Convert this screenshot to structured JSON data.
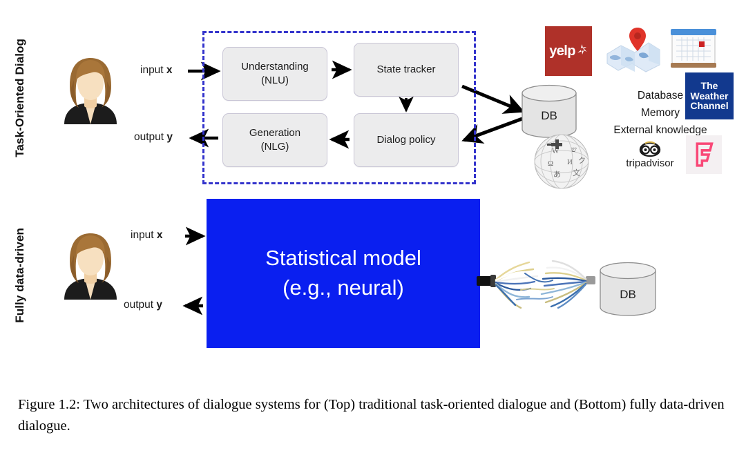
{
  "figure": {
    "caption": "Figure 1.2: Two architectures of dialogue systems for (Top) traditional task-oriented dialogue and (Bottom) fully data-driven dialogue."
  },
  "rows": {
    "top": {
      "label": "Task-Oriented Dialog",
      "avatar_name": "user-avatar-woman",
      "io": {
        "input_prefix": "input ",
        "input_var": "x",
        "output_prefix": "output ",
        "output_var": "y"
      },
      "pipeline": {
        "border_color": "#3333cc",
        "boxes": [
          {
            "id": "nlu",
            "line1": "Understanding",
            "line2": "(NLU)"
          },
          {
            "id": "state_tracker",
            "line1": "State tracker",
            "line2": ""
          },
          {
            "id": "dialog_policy",
            "line1": "Dialog policy",
            "line2": ""
          },
          {
            "id": "nlg",
            "line1": "Generation",
            "line2": "(NLG)"
          }
        ]
      },
      "db": {
        "label": "DB"
      },
      "knowledge": {
        "lines": [
          "Database",
          "Memory",
          "External knowledge"
        ]
      },
      "logos": [
        {
          "id": "yelp",
          "name": "yelp-logo",
          "text": "yelp",
          "color": "#af3129"
        },
        {
          "id": "google_maps",
          "name": "google-maps-logo",
          "text": "",
          "color": "#d93025"
        },
        {
          "id": "calendar",
          "name": "calendar-logo",
          "text": "",
          "color": "#4a90d9"
        },
        {
          "id": "weather_channel",
          "name": "weather-channel-logo",
          "text": "The Weather Channel",
          "color": "#12398e"
        },
        {
          "id": "wikipedia",
          "name": "wikipedia-logo",
          "text": "",
          "color": "#9a9a9a"
        },
        {
          "id": "tripadvisor",
          "name": "tripadvisor-logo",
          "text": "tripadvisor",
          "color": "#1c1c1c"
        },
        {
          "id": "foursquare",
          "name": "foursquare-logo",
          "text": "",
          "color": "#f94877"
        }
      ],
      "weather_lines": [
        "The",
        "Weather",
        "Channel"
      ]
    },
    "bottom": {
      "label": "Fully data-driven",
      "avatar_name": "user-avatar-woman",
      "io": {
        "input_prefix": "input ",
        "input_var": "x",
        "output_prefix": "output ",
        "output_var": "y"
      },
      "model": {
        "line1": "Statistical model",
        "line2": "(e.g., neural)",
        "bg_color": "#0a1ff0",
        "text_color": "#ffffff"
      },
      "db": {
        "label": "DB"
      },
      "connector_name": "frayed-cable-bundle"
    }
  },
  "colors": {
    "dashed_border": "#3333cc",
    "box_fill": "#ececed",
    "box_border": "#c9c6d6",
    "model_blue": "#0a1ff0",
    "arrow": "#000000",
    "cylinder_fill": "#e4e4e4"
  }
}
